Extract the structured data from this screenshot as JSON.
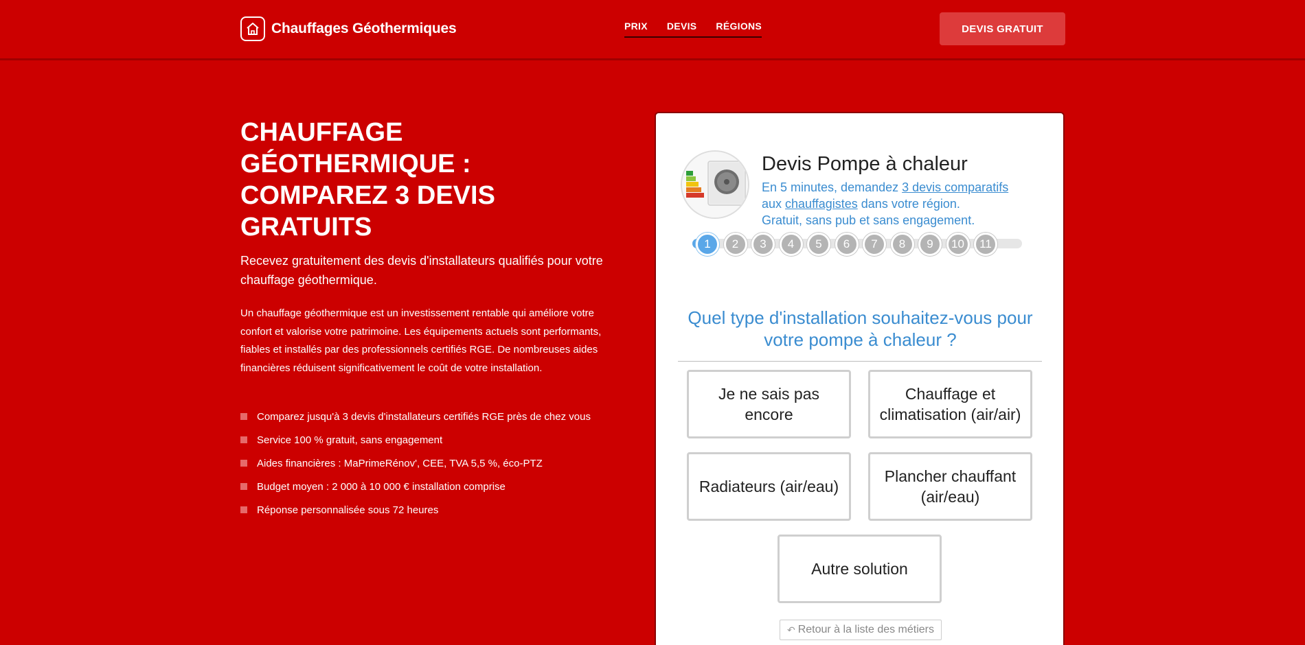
{
  "header": {
    "logo_text": "Chauffages Géothermiques",
    "nav": [
      "PRIX",
      "DEVIS",
      "RÉGIONS"
    ],
    "cta_label": "DEVIS GRATUIT"
  },
  "hero": {
    "title": "CHAUFFAGE GÉOTHERMIQUE : COMPAREZ 3 DEVIS GRATUITS",
    "subtitle": "Recevez gratuitement des devis d'installateurs qualifiés pour votre chauffage géothermique.",
    "description": "Un chauffage géothermique est un investissement rentable qui améliore votre confort et valorise votre patrimoine. Les équipements actuels sont performants, fiables et installés par des professionnels certifiés RGE. De nombreuses aides financières réduisent significativement le coût de votre installation.",
    "bullets": [
      "Comparez jusqu'à 3 devis d'installateurs certifiés RGE près de chez vous",
      "Service 100 % gratuit, sans engagement",
      "Aides financières : MaPrimeRénov', CEE, TVA 5,5 %, éco-PTZ",
      "Budget moyen : 2 000 à 10 000 € installation comprise",
      "Réponse personnalisée sous 72 heures"
    ]
  },
  "form": {
    "title": "Devis Pompe à chaleur",
    "sub_line1_pre": "En 5 minutes, demandez ",
    "sub_link1": "3 devis comparatifs",
    "sub_line2_pre": "aux ",
    "sub_link2": "chauffagistes",
    "sub_line2_post": " dans votre région.",
    "sub_line3": "Gratuit, sans pub et sans engagement.",
    "steps": [
      "1",
      "2",
      "3",
      "4",
      "5",
      "6",
      "7",
      "8",
      "9",
      "10",
      "11"
    ],
    "current_step": 1,
    "question": "Quel type d'installation souhaitez-vous pour votre pompe à chaleur ?",
    "options": [
      "Je ne sais pas encore",
      "Chauffage et climatisation (air/air)",
      "Radiateurs (air/eau)",
      "Plancher chauffant (air/eau)",
      "Autre solution"
    ],
    "back_label": "Retour à la liste des métiers"
  },
  "colors": {
    "background": "#cc0000",
    "accent_blue": "#3a8cd0",
    "cta": "#dd3b3b"
  }
}
